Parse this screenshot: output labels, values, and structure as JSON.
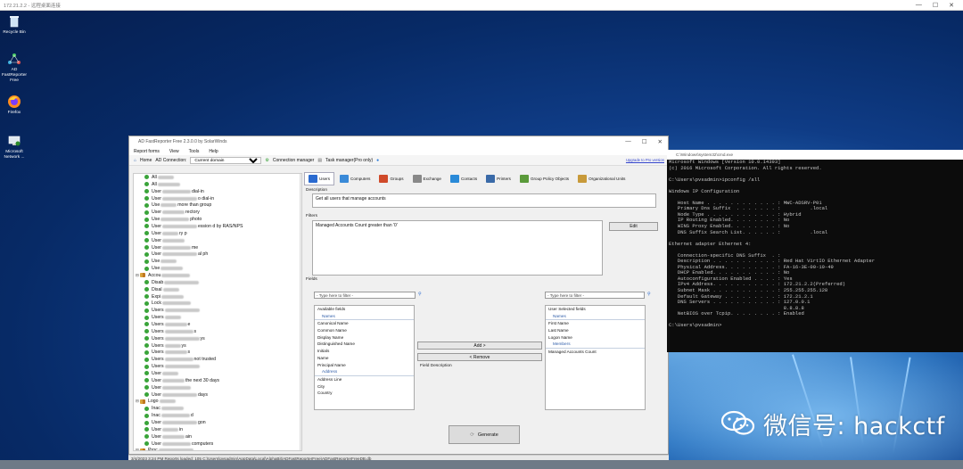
{
  "rdp": {
    "title": "172.21.2.2 - 远程桌面连接",
    "controls": [
      "—",
      "☐",
      "✕"
    ]
  },
  "desktop_icons": [
    {
      "label": "Recycle Bin"
    },
    {
      "label": "AD FastReporter Free"
    },
    {
      "label": "Firefox"
    },
    {
      "label": "Microsoft Network ..."
    }
  ],
  "app": {
    "title": "AD FastReporter Free 2.3.0.0 by SolarWinds",
    "window_controls": [
      "—",
      "☐",
      "✕"
    ],
    "menu": [
      "Report forms",
      "View",
      "Tools",
      "Help"
    ],
    "toolbar": {
      "home": "Home",
      "ad_connection": "AD Connection:",
      "domain_value": "Current domain",
      "connection_manager": "Connection manager",
      "task_manager": "Task manager(Pro only)",
      "upgrade_link": "Upgrade to Pro version"
    },
    "tree": [
      {
        "kind": "leaf",
        "text": "All ",
        "suffix": ""
      },
      {
        "kind": "leaf",
        "text": "All ",
        "suffix": ""
      },
      {
        "kind": "leaf",
        "text": "User",
        "suffix": "dial-in"
      },
      {
        "kind": "leaf",
        "text": "User",
        "suffix": "o dial-in"
      },
      {
        "kind": "leaf",
        "text": "Use",
        "suffix": "more than group"
      },
      {
        "kind": "leaf",
        "text": "User",
        "suffix": "rectory"
      },
      {
        "kind": "leaf",
        "text": "Use",
        "suffix": "photo"
      },
      {
        "kind": "leaf",
        "text": "User",
        "suffix": "ession  d by RAS/NPS"
      },
      {
        "kind": "leaf",
        "text": "User",
        "suffix": "ry p"
      },
      {
        "kind": "leaf",
        "text": "User",
        "suffix": ""
      },
      {
        "kind": "leaf",
        "text": "User",
        "suffix": "me"
      },
      {
        "kind": "leaf",
        "text": "User",
        "suffix": "al ph"
      },
      {
        "kind": "leaf",
        "text": "Use",
        "suffix": ""
      },
      {
        "kind": "leaf",
        "text": "Use",
        "suffix": ""
      },
      {
        "kind": "group",
        "text": "Accou",
        "suffix": ""
      },
      {
        "kind": "leaf",
        "text": "Disab",
        "suffix": ""
      },
      {
        "kind": "leaf",
        "text": "Disal",
        "suffix": ""
      },
      {
        "kind": "leaf",
        "text": "Expi",
        "suffix": ""
      },
      {
        "kind": "leaf",
        "text": "Lock",
        "suffix": ""
      },
      {
        "kind": "leaf",
        "text": "Users",
        "suffix": ""
      },
      {
        "kind": "leaf",
        "text": "Users",
        "suffix": ""
      },
      {
        "kind": "leaf",
        "text": "Users",
        "suffix": "e"
      },
      {
        "kind": "leaf",
        "text": "Users",
        "suffix": "s"
      },
      {
        "kind": "leaf",
        "text": "Users",
        "suffix": "ys"
      },
      {
        "kind": "leaf",
        "text": "Users",
        "suffix": "ys"
      },
      {
        "kind": "leaf",
        "text": "Users",
        "suffix": "s"
      },
      {
        "kind": "leaf",
        "text": "Users",
        "suffix": "not trusted"
      },
      {
        "kind": "leaf",
        "text": "Users",
        "suffix": ""
      },
      {
        "kind": "leaf",
        "text": "User",
        "suffix": ""
      },
      {
        "kind": "leaf",
        "text": "User",
        "suffix": "the next 30 days"
      },
      {
        "kind": "leaf",
        "text": "User",
        "suffix": ""
      },
      {
        "kind": "leaf",
        "text": "User",
        "suffix": "days"
      },
      {
        "kind": "group",
        "text": "Logo",
        "suffix": ""
      },
      {
        "kind": "leaf",
        "text": "Inac",
        "suffix": ""
      },
      {
        "kind": "leaf",
        "text": "Inac",
        "suffix": "d"
      },
      {
        "kind": "leaf",
        "text": "User",
        "suffix": "gon"
      },
      {
        "kind": "leaf",
        "text": "User",
        "suffix": "in"
      },
      {
        "kind": "leaf",
        "text": "User",
        "suffix": "ain"
      },
      {
        "kind": "leaf",
        "text": "User",
        "suffix": "computers"
      },
      {
        "kind": "group",
        "text": "Proc",
        "suffix": ""
      }
    ],
    "categories": [
      "Users",
      "Computers",
      "Groups",
      "Exchange",
      "Contacts",
      "Printers",
      "Group Policy Objects",
      "Organizational Units"
    ],
    "description_label": "Description",
    "description_text": "Get all users that manage accounts",
    "filters_label": "Filters",
    "filters_text": "Managed Accounts Count greater than '0'",
    "edit_button": "Edit",
    "fields_label": "Fields",
    "filter_placeholder": "- Type here to filter -",
    "available_fields": [
      "Available fields",
      "Names",
      "Canonical Name",
      "Common Name",
      "Display Name",
      "Distinguished Name",
      "Initials",
      "Name",
      "Principal Name",
      "Address",
      "Address Line",
      "City",
      "Country"
    ],
    "selected_fields": [
      "User Selected fields",
      "Names",
      "First Name",
      "Last Name",
      "Logon Name",
      "Members",
      "Managed Accounts Count"
    ],
    "add_button": "Add  >",
    "remove_button": "<  Remove",
    "field_description_label": "Field Description",
    "generate_button": "Generate"
  },
  "status_bar": "3/4/2023 3:24 PM   Reports loaded: 105  C:\\Users\\pvsadmin\\AppData\\Local\\AlphaBit\\ADFastReporterFree\\ADFastReporterFreeDB.db",
  "cmd": {
    "title": "C:\\Windows\\system32\\cmd.exe",
    "lines": [
      "Microsoft Windows [Version 10.0.14393]",
      "(c) 2016 Microsoft Corporation. All rights reserved.",
      "",
      "C:\\Users\\pvsadmin>ipconfig /all",
      "",
      "Windows IP Configuration",
      "",
      "   Host Name . . . . . . . . . . . . : MWC-ADSRV-P01",
      "   Primary Dns Suffix  . . . . . . . :          .local",
      "   Node Type . . . . . . . . . . . . : Hybrid",
      "   IP Routing Enabled. . . . . . . . : No",
      "   WINS Proxy Enabled. . . . . . . . : No",
      "   DNS Suffix Search List. . . . . . :          .local",
      "",
      "Ethernet adapter Ethernet 4:",
      "",
      "   Connection-specific DNS Suffix  . :",
      "   Description . . . . . . . . . . . : Red Hat VirtIO Ethernet Adapter",
      "   Physical Address. . . . . . . . . : FA-16-3E-00-10-49",
      "   DHCP Enabled. . . . . . . . . . . : No",
      "   Autoconfiguration Enabled . . . . : Yes",
      "   IPv4 Address. . . . . . . . . . . : 172.21.2.2(Preferred)",
      "   Subnet Mask . . . . . . . . . . . : 255.255.255.128",
      "   Default Gateway . . . . . . . . . : 172.21.2.1",
      "   DNS Servers . . . . . . . . . . . : 127.0.0.1",
      "                                       8.8.8.8",
      "   NetBIOS over Tcpip. . . . . . . . : Enabled",
      "",
      "C:\\Users\\pvsadmin>"
    ]
  },
  "watermark": "微信号: hackctf",
  "colors": {
    "desktop_dark": "#051d4d",
    "desktop_light": "#6fb0e8",
    "cmd_bg": "#0c0c0c",
    "tree_dot": "#3aa43a"
  }
}
